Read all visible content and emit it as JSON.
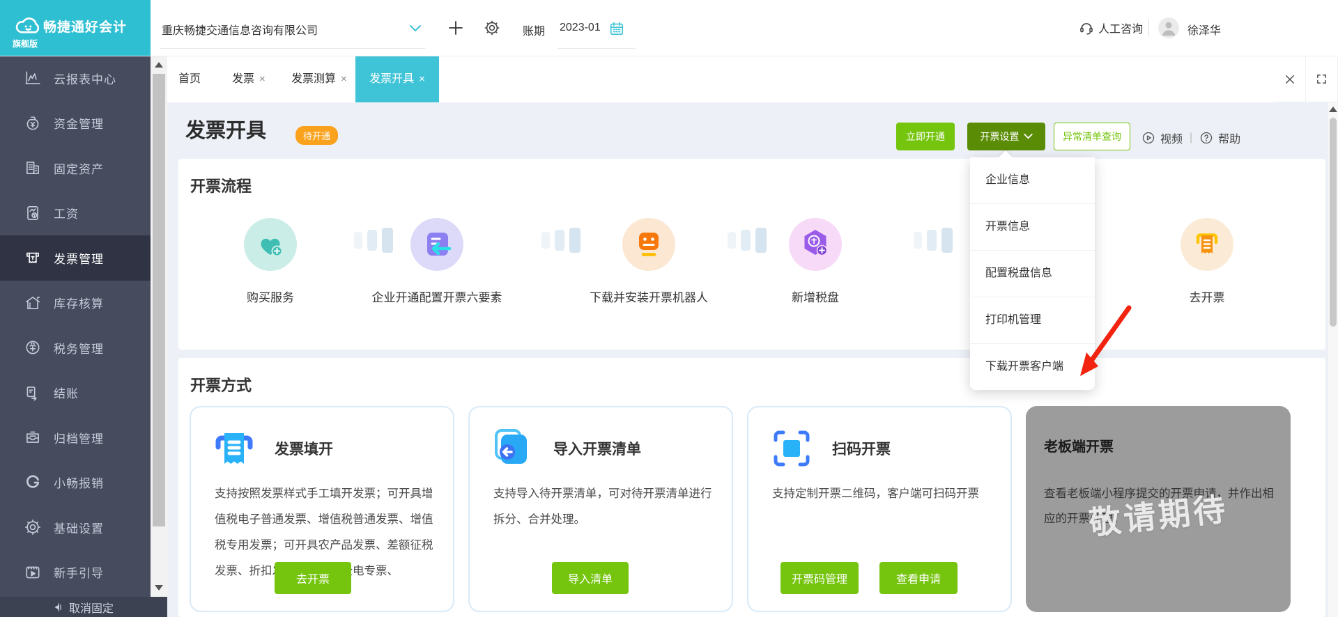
{
  "brand": {
    "logo_text": "畅捷通好会计",
    "edition": "旗舰版"
  },
  "header": {
    "company": "重庆畅捷交通信息咨询有限公司",
    "period_label": "账期",
    "period_value": "2023-01",
    "support_label": "人工咨询",
    "username": "徐泽华"
  },
  "tabs": {
    "close_glyph": "×",
    "items": [
      {
        "label": "首页"
      },
      {
        "label": "发票"
      },
      {
        "label": "发票测算"
      },
      {
        "label": "发票开具"
      }
    ]
  },
  "sidebar": {
    "items": [
      {
        "label": "云报表中心"
      },
      {
        "label": "资金管理"
      },
      {
        "label": "固定资产"
      },
      {
        "label": "工资"
      },
      {
        "label": "发票管理"
      },
      {
        "label": "库存核算"
      },
      {
        "label": "税务管理"
      },
      {
        "label": "结账"
      },
      {
        "label": "归档管理"
      },
      {
        "label": "小畅报销"
      },
      {
        "label": "基础设置"
      },
      {
        "label": "新手引导"
      }
    ],
    "unpin_label": "取消固定"
  },
  "page": {
    "title": "发票开具",
    "status_badge": "待开通",
    "activate_button": "立即开通",
    "settings_button": "开票设置",
    "abnormal_button": "异常清单查询",
    "video_label": "视频",
    "help_label": "帮助",
    "settings_menu": [
      {
        "label": "企业信息"
      },
      {
        "label": "开票信息"
      },
      {
        "label": "配置税盘信息"
      },
      {
        "label": "打印机管理"
      },
      {
        "label": "下载开票客户端"
      }
    ]
  },
  "flow": {
    "title": "开票流程",
    "steps": [
      {
        "label": "购买服务"
      },
      {
        "label": "企业开通配置开票六要素"
      },
      {
        "label": "下载并安装开票机器人"
      },
      {
        "label": "新增税盘"
      },
      {
        "label": "去开票"
      }
    ]
  },
  "methods": {
    "title": "开票方式",
    "cards": [
      {
        "title": "发票填开",
        "desc": "支持按照发票样式手工填开发票；可开具增值税电子普通发票、增值税普通发票、增值税专用发票；可开具农产品发票、差额征税发票、折扣发票；可开具全电专票、",
        "buttons": [
          "去开票"
        ]
      },
      {
        "title": "导入开票清单",
        "desc": "支持导入待开票清单，可对待开票清单进行拆分、合并处理。",
        "buttons": [
          "导入清单"
        ]
      },
      {
        "title": "扫码开票",
        "desc": "支持定制开票二维码，客户端可扫码开票",
        "buttons": [
          "开票码管理",
          "查看申请"
        ]
      },
      {
        "title": "老板端开票",
        "desc": "查看老板端小程序提交的开票申请，并作出相应的开票处理。",
        "watermark": "敬请期待"
      }
    ]
  },
  "colors": {
    "brand_cyan": "#2EBFD3",
    "green": "#75C40D",
    "dark_green": "#5B8C06",
    "orange_badge": "#FAA21C",
    "sidebar_bg": "#464B5E",
    "disabled_card_gray": "#9C9C9C",
    "annotation_red": "#F2230F"
  }
}
